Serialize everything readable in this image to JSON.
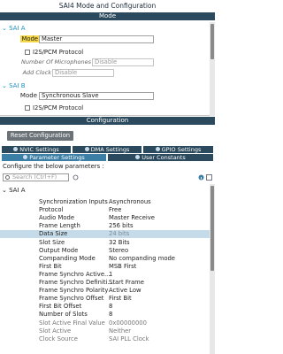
{
  "window": {
    "title": "SAI4 Mode and Configuration"
  },
  "mode_section": {
    "header": "Mode"
  },
  "sai_a": {
    "group_label": "SAI A",
    "mode_label": "Mode",
    "mode_value": "Master",
    "i2s_label": "I2S/PCM Protocol",
    "num_mics_label": "Number Of Microphones",
    "num_mics_value": "Disable",
    "add_clock_label": "Add Clock",
    "add_clock_value": "Disable"
  },
  "sai_b": {
    "group_label": "SAI B",
    "mode_label": "Mode",
    "mode_value": "Synchronous Slave",
    "i2s_label": "I2S/PCM Protocol"
  },
  "config_section": {
    "header": "Configuration"
  },
  "reset_button": "Reset Configuration",
  "tabs": [
    {
      "label": "NVIC Settings"
    },
    {
      "label": "DMA Settings"
    },
    {
      "label": "GPIO Settings"
    },
    {
      "label": "Parameter Settings"
    },
    {
      "label": "User Constants"
    }
  ],
  "configure_text": "Configure the below parameters :",
  "search": {
    "placeholder": "Search (Ctrl+F)"
  },
  "params_group": "SAI A",
  "params": [
    {
      "key": "Synchronization Inputs",
      "value": "Asynchronous"
    },
    {
      "key": "Protocol",
      "value": "Free"
    },
    {
      "key": "Audio Mode",
      "value": "Master Receive"
    },
    {
      "key": "Frame Length",
      "value": "256 bits"
    },
    {
      "key": "Data Size",
      "value": "24 bits"
    },
    {
      "key": "Slot Size",
      "value": "32 Bits"
    },
    {
      "key": "Output Mode",
      "value": "Stereo"
    },
    {
      "key": "Companding Mode",
      "value": "No companding mode"
    },
    {
      "key": "First Bit",
      "value": "MSB First"
    },
    {
      "key": "Frame Synchro Active...",
      "value": "1"
    },
    {
      "key": "Frame Synchro Definiti...",
      "value": "Start Frame"
    },
    {
      "key": "Frame Synchro Polarity",
      "value": "Active Low"
    },
    {
      "key": "Frame Synchro Offset",
      "value": "First Bit"
    },
    {
      "key": "First Bit Offset",
      "value": "8"
    },
    {
      "key": "Number of Slots",
      "value": "8"
    },
    {
      "key": "Slot Active Final Value",
      "value": "0x00000000"
    },
    {
      "key": "Slot Active",
      "value": "Neither"
    },
    {
      "key": "Clock Source",
      "value": "SAI PLL Clock"
    }
  ]
}
